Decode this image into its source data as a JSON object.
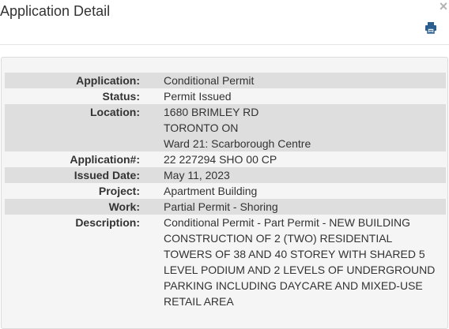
{
  "modal": {
    "title": "Application Detail",
    "close_glyph": "×",
    "print_icon": "printer-icon"
  },
  "details": {
    "application_label": "Application:",
    "application_value": "Conditional Permit",
    "status_label": "Status:",
    "status_value": "Permit Issued",
    "location_label": "Location:",
    "location_lines": [
      "1680 BRIMLEY RD",
      "TORONTO ON",
      "Ward 21: Scarborough Centre"
    ],
    "application_no_label": "Application#:",
    "application_no_value": "22 227294 SHO 00 CP",
    "issued_date_label": "Issued Date:",
    "issued_date_value": "May 11, 2023",
    "project_label": "Project:",
    "project_value": "Apartment Building",
    "work_label": "Work:",
    "work_value": "Partial Permit - Shoring",
    "description_label": "Description:",
    "description_lines": [
      "Conditional Permit - Part Permit - NEW BUILDING",
      "CONSTRUCTION OF 2 (TWO) RESIDENTIAL",
      "TOWERS OF 38 AND 40 STOREY WITH SHARED 5",
      "LEVEL PODIUM AND 2 LEVELS OF UNDERGROUND",
      "PARKING INCLUDING DAYCARE AND MIXED-USE",
      "RETAIL AREA"
    ]
  },
  "colors": {
    "row_shade": "#dedede",
    "panel_bg": "#f5f5f5",
    "print_icon": "#2a5f8f",
    "close_icon": "#b4b4b4"
  }
}
